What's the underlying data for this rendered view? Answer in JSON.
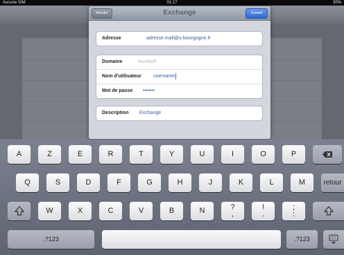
{
  "status_bar": {
    "carrier": "Aucune SIM",
    "time": "01:17",
    "battery": "30%"
  },
  "nav": {
    "title": "Exchange",
    "cancel_label": "Annuler",
    "next_label": "Suivant"
  },
  "form": {
    "address": {
      "label": "Adresse",
      "value": "adresse.mail@u-bourgogne.fr"
    },
    "domain": {
      "label": "Domaine",
      "placeholder": "facultatif"
    },
    "username": {
      "label": "Nom d'utilisateur",
      "value": "username"
    },
    "password": {
      "label": "Mot de passe",
      "value": "•••••••"
    },
    "description": {
      "label": "Description",
      "value": "Exchange"
    }
  },
  "keyboard": {
    "row1": [
      "A",
      "Z",
      "E",
      "R",
      "T",
      "Y",
      "U",
      "I",
      "O",
      "P"
    ],
    "row2": [
      "Q",
      "S",
      "D",
      "F",
      "G",
      "H",
      "J",
      "K",
      "L",
      "M"
    ],
    "row3": [
      "W",
      "X",
      "C",
      "V",
      "B",
      "N"
    ],
    "row3_punct": [
      {
        "top": "?",
        "bottom": ","
      },
      {
        "top": "!",
        "bottom": "."
      },
      {
        "top": ";",
        "bottom": ":"
      }
    ],
    "return_label": "retour",
    "numbers_label": ".?123",
    "icons": {
      "backspace": "backspace-icon",
      "shift": "shift-icon",
      "dismiss": "keyboard-dismiss-icon"
    }
  },
  "colors": {
    "accent": "#2f68d2",
    "value_text": "#3c5d95"
  }
}
